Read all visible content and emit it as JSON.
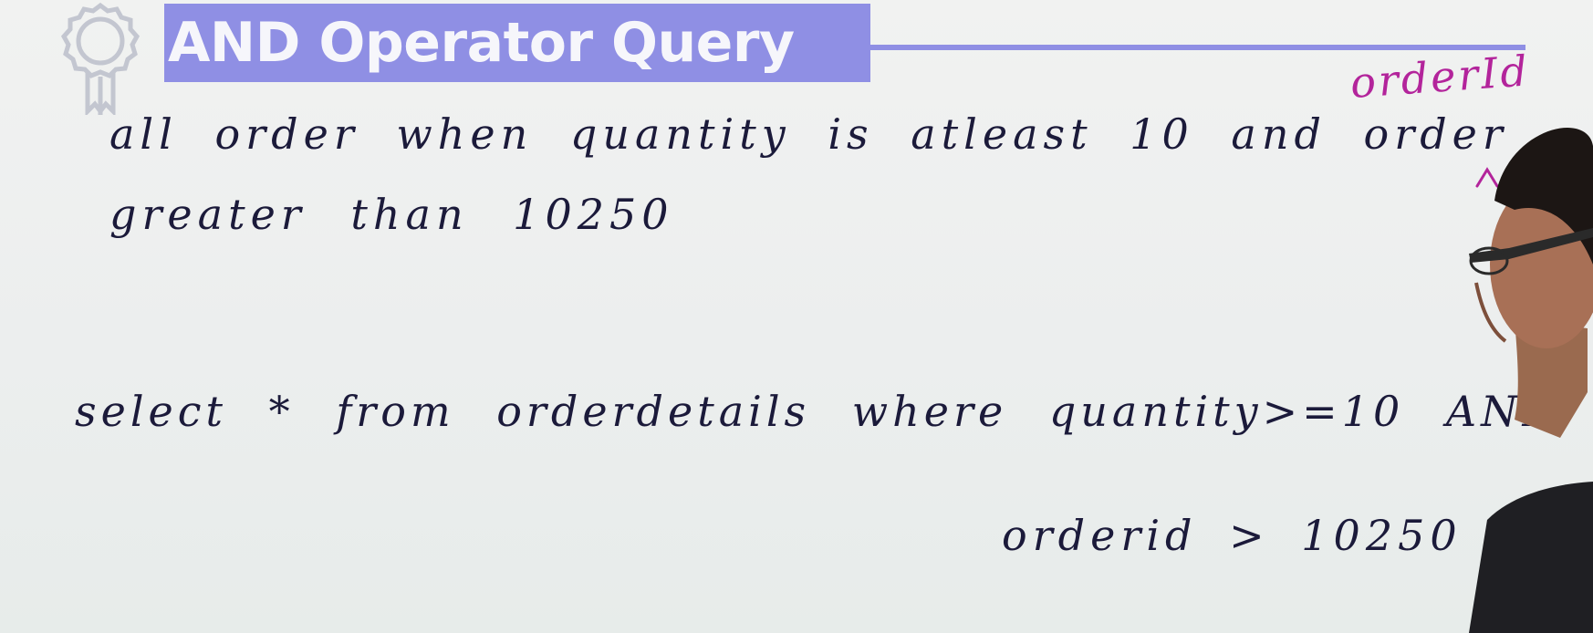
{
  "title": "AND Operator Query",
  "icons": {
    "badge": "award-ribbon-icon",
    "caret": "insertion-caret-mark"
  },
  "colors": {
    "title_band": "#8f8fe4",
    "ink": "#1b1a3a",
    "annotation_ink": "#b3249b",
    "board": "#eceeed"
  },
  "board": {
    "line1": "all order when quantity is atleast 10 and order",
    "line2": "greater than 10250",
    "annotation": "orderId",
    "query_line1": "select * from orderdetails where quantity>=10 AND",
    "query_line2": "orderid > 10250"
  }
}
